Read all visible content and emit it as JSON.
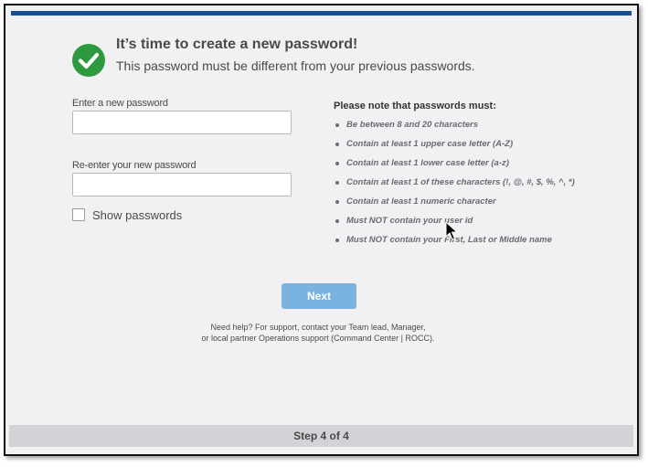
{
  "header": {
    "title": "It’s time to create a new password!",
    "subtitle": "This password must be different from your previous passwords."
  },
  "form": {
    "new_password_label": "Enter a new password",
    "new_password_value": "",
    "reenter_label": "Re-enter your new password",
    "reenter_value": "",
    "show_passwords_label": "Show passwords",
    "show_passwords_checked": false
  },
  "rules": {
    "title": "Please note that passwords must:",
    "items": [
      "Be between 8 and 20 characters",
      "Contain at least 1 upper case letter (A-Z)",
      "Contain at least 1 lower case letter (a-z)",
      "Contain at least 1 of these characters (!, @, #, $, %, ^, *)",
      "Contain at least 1 numeric character",
      "Must NOT contain your user id",
      "Must NOT contain your First, Last or Middle name"
    ]
  },
  "actions": {
    "next_label": "Next"
  },
  "help": {
    "line1": "Need help?  For support, contact your Team lead, Manager,",
    "line2": "or local partner Operations support (Command Center | ROCC)."
  },
  "footer": {
    "step_label": "Step 4 of 4"
  },
  "colors": {
    "accent_bar": "#1b4f93",
    "success": "#2e9a3f",
    "button": "#7ab3e0"
  },
  "icons": {
    "status": "checkmark-circle-icon",
    "pointer": "mouse-cursor-icon"
  }
}
